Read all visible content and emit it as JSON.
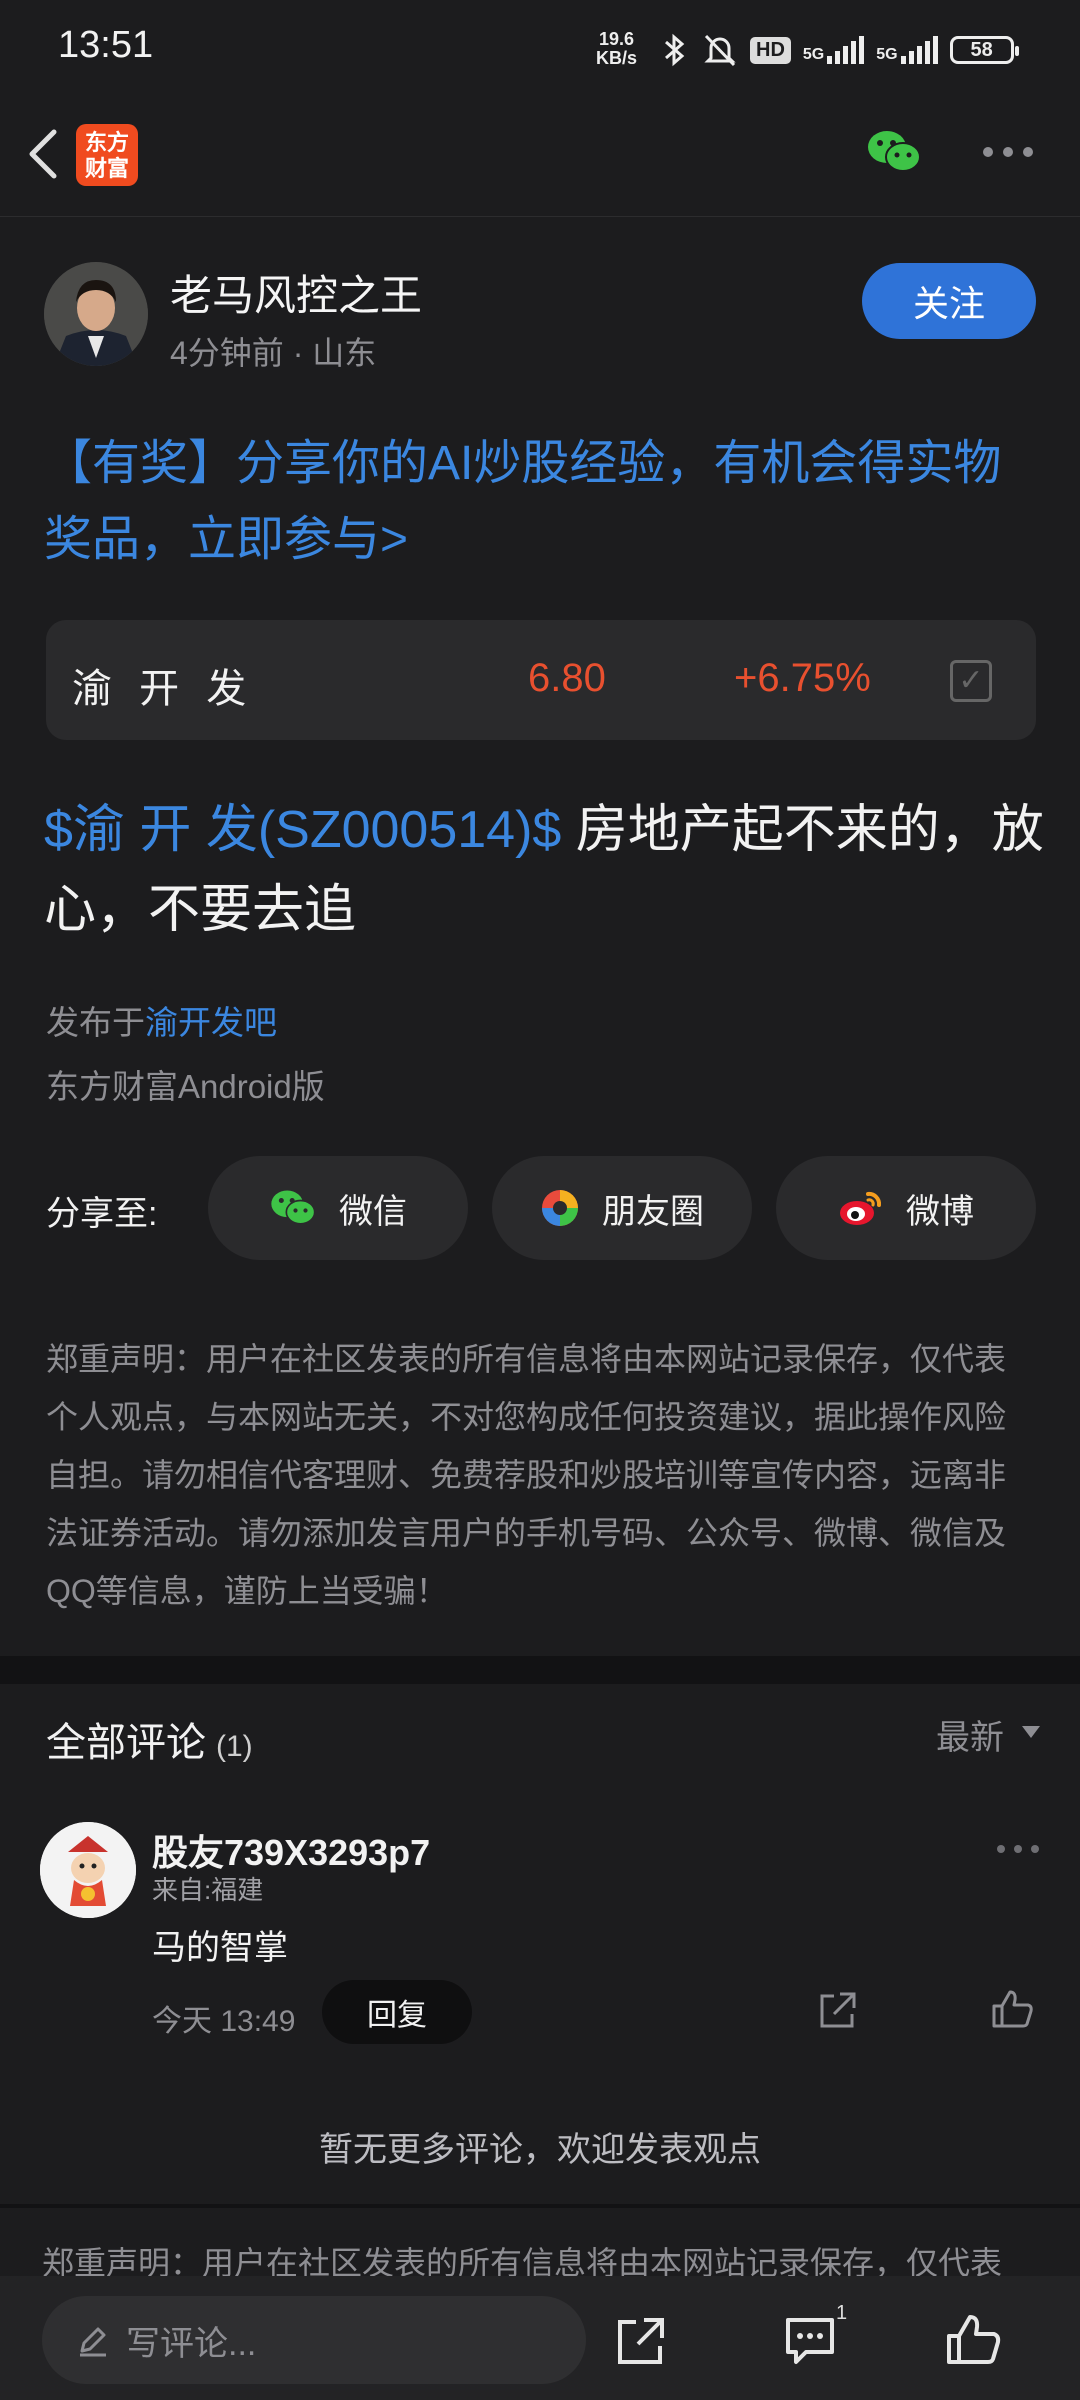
{
  "status_bar": {
    "time": "13:51",
    "net_speed_value": "19.6",
    "net_speed_unit": "KB/s",
    "hd_label": "HD",
    "network_1": "5G",
    "network_2": "5G",
    "battery": "58"
  },
  "header": {
    "logo_line1": "东方",
    "logo_line2": "财富"
  },
  "post": {
    "author": "老马风控之王",
    "time": "4分钟前",
    "location": "山东",
    "follow_label": "关注",
    "promo_text": "【有奖】分享你的AI炒股经验，有机会得实物奖品，立即参与>",
    "stock": {
      "name": "渝 开 发",
      "price": "6.80",
      "change": "+6.75%"
    },
    "body_tag": "$渝 开 发(SZ000514)$",
    "body_text": " 房地产起不来的，放心，不要去追",
    "published_prefix": "发布于",
    "forum": "渝开发吧",
    "client": "东方财富Android版"
  },
  "share": {
    "label": "分享至:",
    "buttons": [
      "微信",
      "朋友圈",
      "微博"
    ]
  },
  "disclaimer": "郑重声明：用户在社区发表的所有信息将由本网站记录保存，仅代表个人观点，与本网站无关，不对您构成任何投资建议，据此操作风险自担。请勿相信代客理财、免费荐股和炒股培训等宣传内容，远离非法证券活动。请勿添加发言用户的手机号码、公众号、微博、微信及QQ等信息，谨防上当受骗！",
  "comments": {
    "title": "全部评论",
    "count": "(1)",
    "sort_label": "最新",
    "items": [
      {
        "user": "股友739X3293p7",
        "from": "来自:福建",
        "text": "马的智掌",
        "time": "今天 13:49",
        "reply_label": "回复"
      }
    ],
    "no_more": "暂无更多评论，欢迎发表观点",
    "disclaimer_truncated": "郑重声明：用户在社区发表的所有信息将由本网站记录保存，仅代表"
  },
  "bottom_bar": {
    "input_placeholder": "写评论...",
    "comment_badge": "1"
  },
  "colors": {
    "background": "#1c1c1e",
    "accent_blue": "#3b87e0",
    "follow_button": "#2f73d8",
    "stock_up_red": "#e8502f",
    "logo_orange": "#f04b1f",
    "wechat_green": "#3ec347"
  }
}
